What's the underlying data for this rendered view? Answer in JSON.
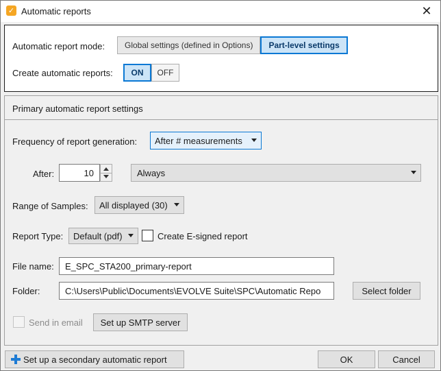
{
  "window": {
    "title": "Automatic reports",
    "app_icon_glyph": "✓",
    "close_glyph": "✕"
  },
  "mode": {
    "label": "Automatic report mode:",
    "options": [
      "Global settings (defined in Options)",
      "Part-level settings"
    ],
    "selected": "Part-level settings"
  },
  "create": {
    "label": "Create automatic reports:",
    "on_label": "ON",
    "off_label": "OFF",
    "selected": "ON"
  },
  "primary": {
    "section_title": "Primary automatic report settings",
    "frequency_label": "Frequency of report generation:",
    "frequency_value": "After # measurements",
    "after_label": "After:",
    "after_value": "10",
    "condition_value": "Always",
    "range_label": "Range of Samples:",
    "range_value": "All displayed (30)",
    "report_type_label": "Report Type:",
    "report_type_value": "Default (pdf)",
    "esigned_label": "Create E-signed report",
    "esigned_checked": false,
    "file_name_label": "File name:",
    "file_name_value": "E_SPC_STA200_primary-report",
    "folder_label": "Folder:",
    "folder_value": "C:\\Users\\Public\\Documents\\EVOLVE Suite\\SPC\\Automatic Repo",
    "select_folder_label": "Select folder",
    "send_email_label": "Send in email",
    "send_email_checked": false,
    "smtp_label": "Set up SMTP server"
  },
  "footer": {
    "secondary_label": "Set up a secondary automatic report",
    "ok_label": "OK",
    "cancel_label": "Cancel"
  },
  "colors": {
    "accent": "#0a78d4",
    "active_fill": "#cce4f7",
    "app_icon": "#f5a623",
    "plus_icon": "#1e7bd4"
  },
  "icons": {
    "app": "app-logo-icon",
    "close": "close-icon",
    "plus": "plus-icon",
    "caret": "chevron-down-icon"
  }
}
